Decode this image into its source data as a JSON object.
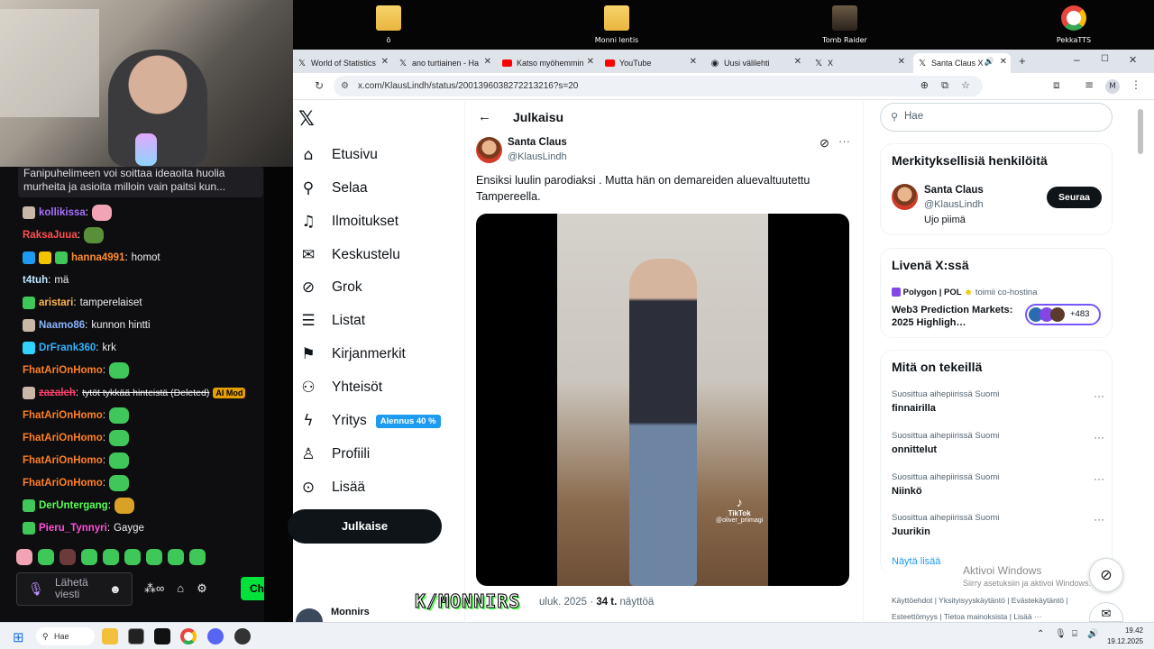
{
  "desktop": {
    "icons": [
      {
        "label": "ö"
      },
      {
        "label": "Monni lentis"
      },
      {
        "label": "Tomb Raider"
      },
      {
        "label": "PekkaTTS"
      }
    ]
  },
  "chat": {
    "pinned_text": "Fanipuhelimeen voi soittaa ideaoita huolia murheita ja asioita milloin vain paitsi kun...",
    "messages": [
      {
        "user": "kollikissa",
        "text": "",
        "color": "#a970ff"
      },
      {
        "user": "RaksaJuua",
        "text": "",
        "color": "#ff4f4f"
      },
      {
        "user": "hanna4991",
        "text": "homot",
        "color": "#ff8c2b"
      },
      {
        "user": "t4tuh",
        "text": "mä",
        "color": "#bfe8ff"
      },
      {
        "user": "aristari",
        "text": "tamperelaiset",
        "color": "#ffb64f"
      },
      {
        "user": "Naamo86",
        "text": "kunnon hintti",
        "color": "#8ab4ff"
      },
      {
        "user": "DrFrank360",
        "text": "krk",
        "color": "#2fb3ff"
      },
      {
        "user": "FhatAriOnHomo",
        "text": "",
        "color": "#ff7f24"
      },
      {
        "user": "zazaleh",
        "text": "tytöt tykkää hinteistä (Deleted)",
        "color": "#ff3f6c"
      },
      {
        "user": "FhatAriOnHomo",
        "text": "",
        "color": "#ff7f24"
      },
      {
        "user": "FhatAriOnHomo",
        "text": "",
        "color": "#ff7f24"
      },
      {
        "user": "FhatAriOnHomo",
        "text": "",
        "color": "#ff7f24"
      },
      {
        "user": "FhatAriOnHomo",
        "text": "",
        "color": "#ff7f24"
      },
      {
        "user": "DerUntergang",
        "text": "",
        "color": "#57ff57"
      },
      {
        "user": "Pieru_Tynnyri",
        "text": "Gayge",
        "color": "#ff4fd8"
      }
    ],
    "ai_mod_badge": "AI Mod",
    "send_placeholder": "Lähetä viesti",
    "chat_button": "Ch"
  },
  "browser": {
    "tabs": [
      {
        "title": "World of Statistics",
        "icon": "x-icon"
      },
      {
        "title": "ano turtiainen - Ha",
        "icon": "x-icon"
      },
      {
        "title": "Katso myöhemmin",
        "icon": "youtube-icon"
      },
      {
        "title": "YouTube",
        "icon": "youtube-icon"
      },
      {
        "title": "Uusi välilehti",
        "icon": "chrome-icon"
      },
      {
        "title": "X",
        "icon": "x-icon"
      },
      {
        "title": "Santa Claus X",
        "icon": "x-icon"
      }
    ],
    "url": "x.com/KlausLindh/status/2001396038272213216?s=20",
    "profile_initial": "M"
  },
  "x": {
    "nav": [
      {
        "label": "Etusivu",
        "icon": "home-icon"
      },
      {
        "label": "Selaa",
        "icon": "search-icon"
      },
      {
        "label": "Ilmoitukset",
        "icon": "bell-icon"
      },
      {
        "label": "Keskustelu",
        "icon": "mail-icon"
      },
      {
        "label": "Grok",
        "icon": "grok-icon"
      },
      {
        "label": "Listat",
        "icon": "list-icon"
      },
      {
        "label": "Kirjanmerkit",
        "icon": "bookmark-icon"
      },
      {
        "label": "Yhteisöt",
        "icon": "communities-icon"
      },
      {
        "label": "Yritys",
        "icon": "lightning-icon"
      },
      {
        "label": "Profiili",
        "icon": "profile-icon"
      },
      {
        "label": "Lisää",
        "icon": "more-icon"
      }
    ],
    "yritys_pill": "Alennus 40 %",
    "post_button": "Julkaise",
    "account_name": "Monnirs",
    "header": "Julkaisu",
    "post": {
      "author": "Santa Claus",
      "handle": "@KlausLindh",
      "text": "Ensiksi luulin parodiaksi . Mutta hän on demareiden aluevaltuutettu Tampereella.",
      "video_watermark": "TikTok",
      "video_handle": "@oliver_priimagi",
      "meta_date": "uluk. 2025 ·",
      "meta_views": "34 t.",
      "meta_views_label": "näyttöä"
    },
    "search_placeholder": "Hae",
    "who_to_follow": {
      "title": "Merkityksellisiä henkilöitä",
      "name": "Santa Claus",
      "handle": "@KlausLindh",
      "bio": "Ujo piimä",
      "follow": "Seuraa"
    },
    "live": {
      "title": "Livenä X:ssä",
      "host": "Polygon | POL",
      "cohost": "toimii co-hostina",
      "space_title": "Web3 Prediction Markets: 2025 Highligh…",
      "count": "+483"
    },
    "trends": {
      "title": "Mitä on tekeillä",
      "items": [
        {
          "context": "Suosittua aihepiirissä Suomi",
          "name": "finnairilla"
        },
        {
          "context": "Suosittua aihepiirissä Suomi",
          "name": "onnittelut"
        },
        {
          "context": "Suosittua aihepiirissä Suomi",
          "name": "Niinkö"
        },
        {
          "context": "Suosittua aihepiirissä Suomi",
          "name": "Juurikin"
        }
      ],
      "show_more": "Näytä lisää"
    },
    "footer": [
      "Käyttöehdot",
      "Yksityisyyskäytäntö",
      "Evästekäytäntö",
      "Esteettömyys",
      "Tietoa mainoksista",
      "Lisää ···"
    ]
  },
  "activate_windows": {
    "title": "Aktivoi Windows",
    "sub": "Siirry asetuksiin ja aktivoi Windows."
  },
  "taskbar": {
    "search": "Hae",
    "time": "19.42",
    "date": "19.12.2025"
  },
  "watermark": "K/MONNIRS"
}
